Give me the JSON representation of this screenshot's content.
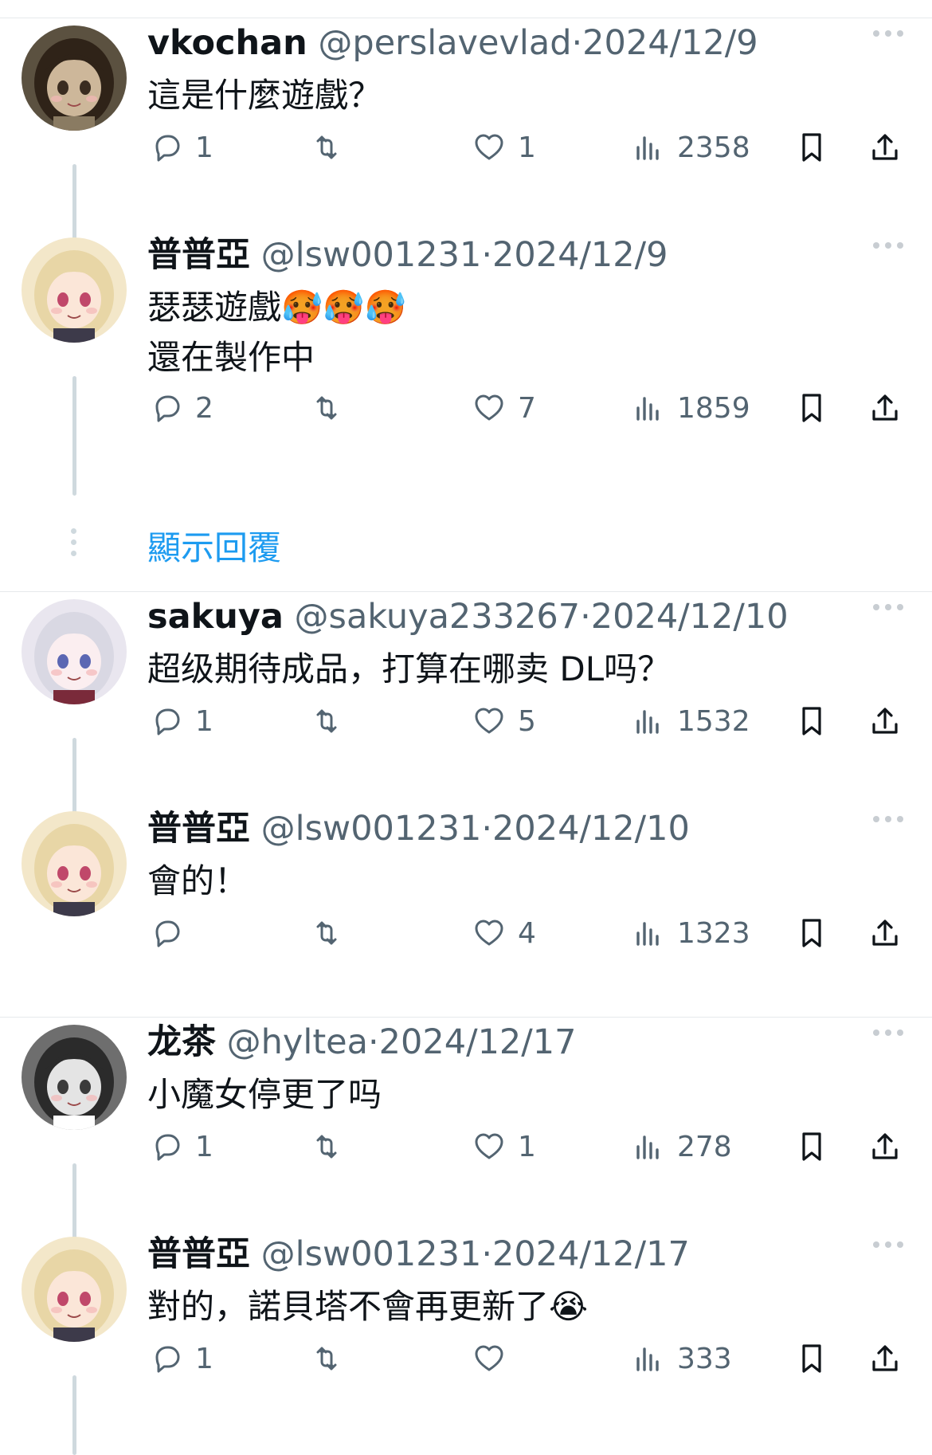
{
  "threads": [
    {
      "tweets": [
        {
          "name": "vkochan",
          "handle": "@perslavevlad",
          "date": "2024/12/9",
          "text": "這是什麼遊戲？",
          "replies": "1",
          "reposts": "",
          "likes": "1",
          "views": "2358",
          "avatar": "dark-anime"
        },
        {
          "name": "普普亞",
          "handle": "@lsw001231",
          "date": "2024/12/9",
          "text": "瑟瑟遊戲🥵🥵🥵\n還在製作中",
          "replies": "2",
          "reposts": "",
          "likes": "7",
          "views": "1859",
          "avatar": "blonde-anime"
        }
      ],
      "show_replies": "顯示回覆"
    },
    {
      "tweets": [
        {
          "name": "sakuya",
          "handle": "@sakuya233267",
          "date": "2024/12/10",
          "text": "超级期待成品，打算在哪卖 DL吗？",
          "replies": "1",
          "reposts": "",
          "likes": "5",
          "views": "1532",
          "avatar": "silver-anime"
        },
        {
          "name": "普普亞",
          "handle": "@lsw001231",
          "date": "2024/12/10",
          "text": "會的！",
          "replies": "",
          "reposts": "",
          "likes": "4",
          "views": "1323",
          "avatar": "blonde-anime"
        }
      ]
    },
    {
      "tweets": [
        {
          "name": "龙茶",
          "handle": "@hyltea",
          "date": "2024/12/17",
          "text": "小魔女停更了吗",
          "replies": "1",
          "reposts": "",
          "likes": "1",
          "views": "278",
          "avatar": "mono-anime"
        },
        {
          "name": "普普亞",
          "handle": "@lsw001231",
          "date": "2024/12/17",
          "text": "對的，諾貝塔不會再更新了😭",
          "replies": "1",
          "reposts": "",
          "likes": "",
          "views": "333",
          "avatar": "blonde-anime"
        }
      ]
    }
  ],
  "colors": {
    "text": "#0f1419",
    "muted": "#536471",
    "link": "#1d9bf0",
    "line": "#cfd9de",
    "divider": "#e6e9ec"
  },
  "icons": {
    "reply": "reply-icon",
    "repost": "repost-icon",
    "like": "heart-icon",
    "views": "views-icon",
    "bookmark": "bookmark-icon",
    "share": "share-icon",
    "more": "more-icon"
  }
}
